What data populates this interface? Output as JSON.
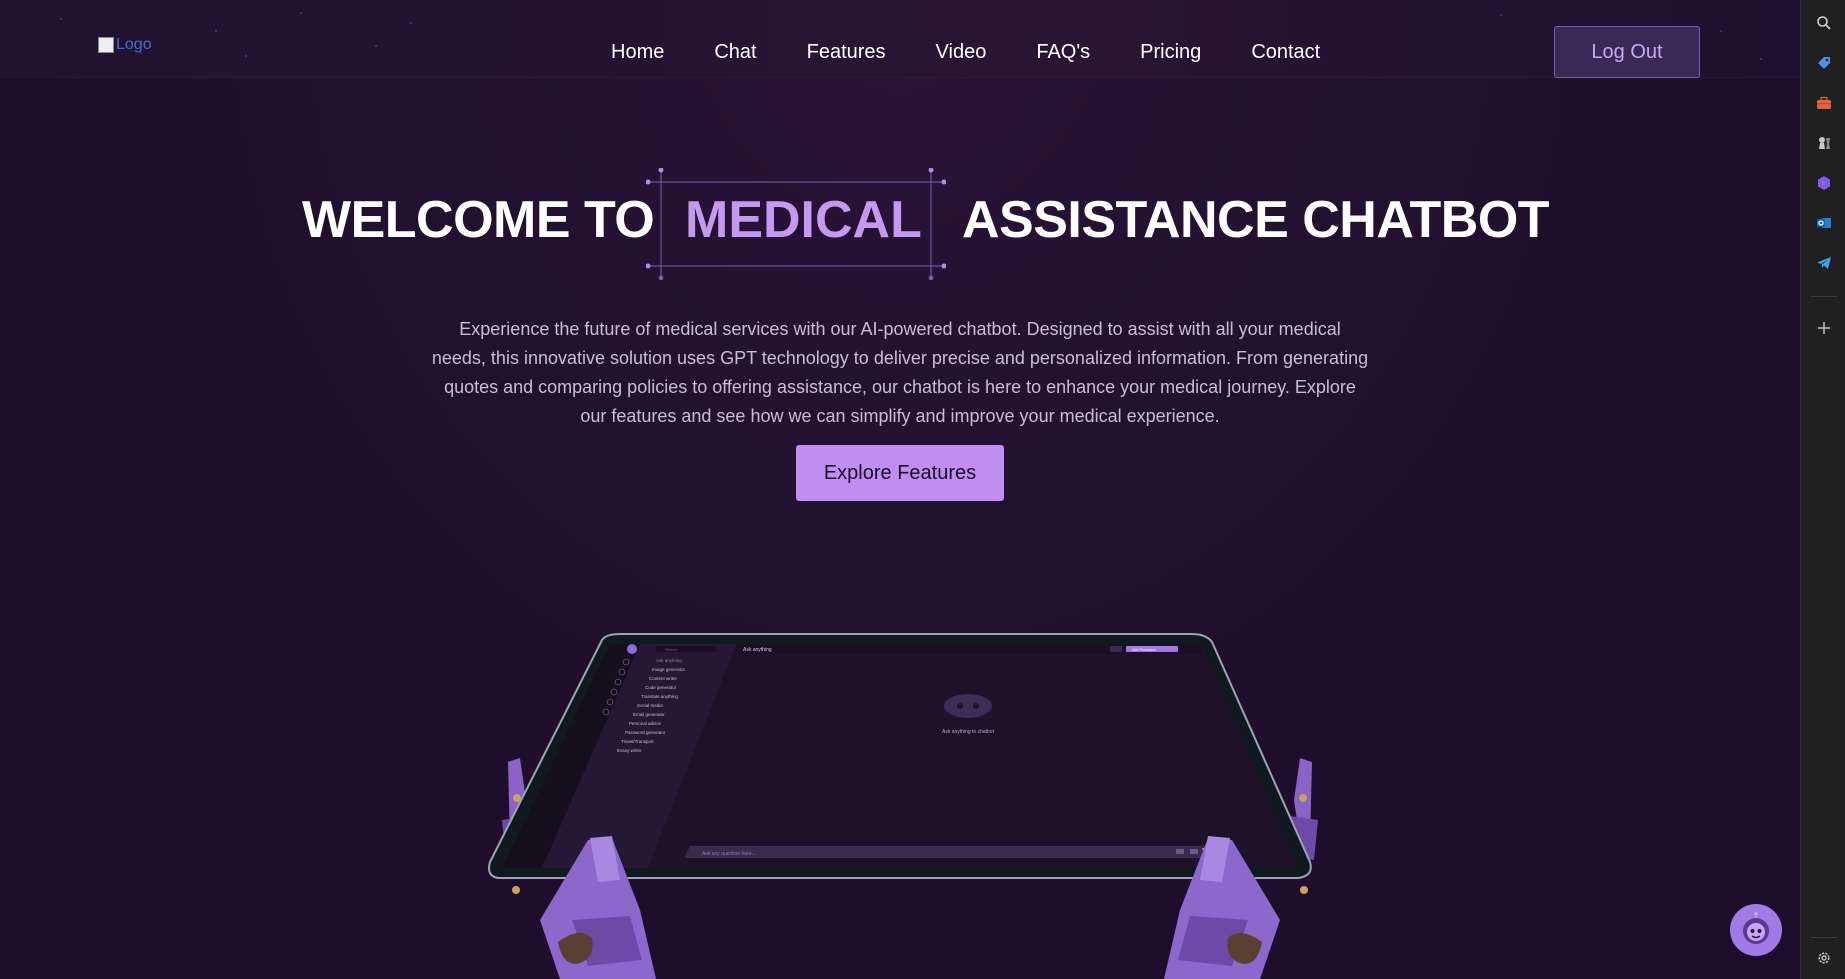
{
  "header": {
    "logo_alt": "Logo",
    "nav": [
      "Home",
      "Chat",
      "Features",
      "Video",
      "FAQ's",
      "Pricing",
      "Contact"
    ],
    "logout_label": "Log Out"
  },
  "hero": {
    "title_part1": "WELCOME TO",
    "title_highlight": "MEDICAL",
    "title_part2": "ASSISTANCE CHATBOT",
    "description": "Experience the future of medical services with our AI-powered chatbot. Designed to assist with all your medical needs, this innovative solution uses GPT technology to deliver precise and personalized information. From generating quotes and comparing policies to offering assistance, our chatbot is here to enhance your medical journey. Explore our features and see how we can simplify and improve your medical experience.",
    "cta_label": "Explore Features"
  },
  "tablet": {
    "search_placeholder": "Search",
    "header_title": "Ask anything",
    "upgrade_label": "Get Premium",
    "menu_items": [
      "Ask anything",
      "Image generator",
      "Content writer",
      "Code generator",
      "Translate anything",
      "Social media",
      "Email generator",
      "Personal advice",
      "Password generator",
      "Travel/Transport",
      "Essay writer"
    ],
    "empty_state": "Ask anything to chatbot",
    "input_placeholder": "Ask any question here..."
  },
  "colors": {
    "background": "#1f0f2c",
    "accent": "#c08ef0",
    "highlight_text": "#c49af0",
    "logout_bg": "#3a2858"
  },
  "browser_sidebar": {
    "icons": [
      "search-icon",
      "tag-icon",
      "briefcase-icon",
      "chess-icon",
      "copilot-icon",
      "outlook-icon",
      "telegram-icon",
      "add-icon",
      "settings-icon"
    ]
  }
}
